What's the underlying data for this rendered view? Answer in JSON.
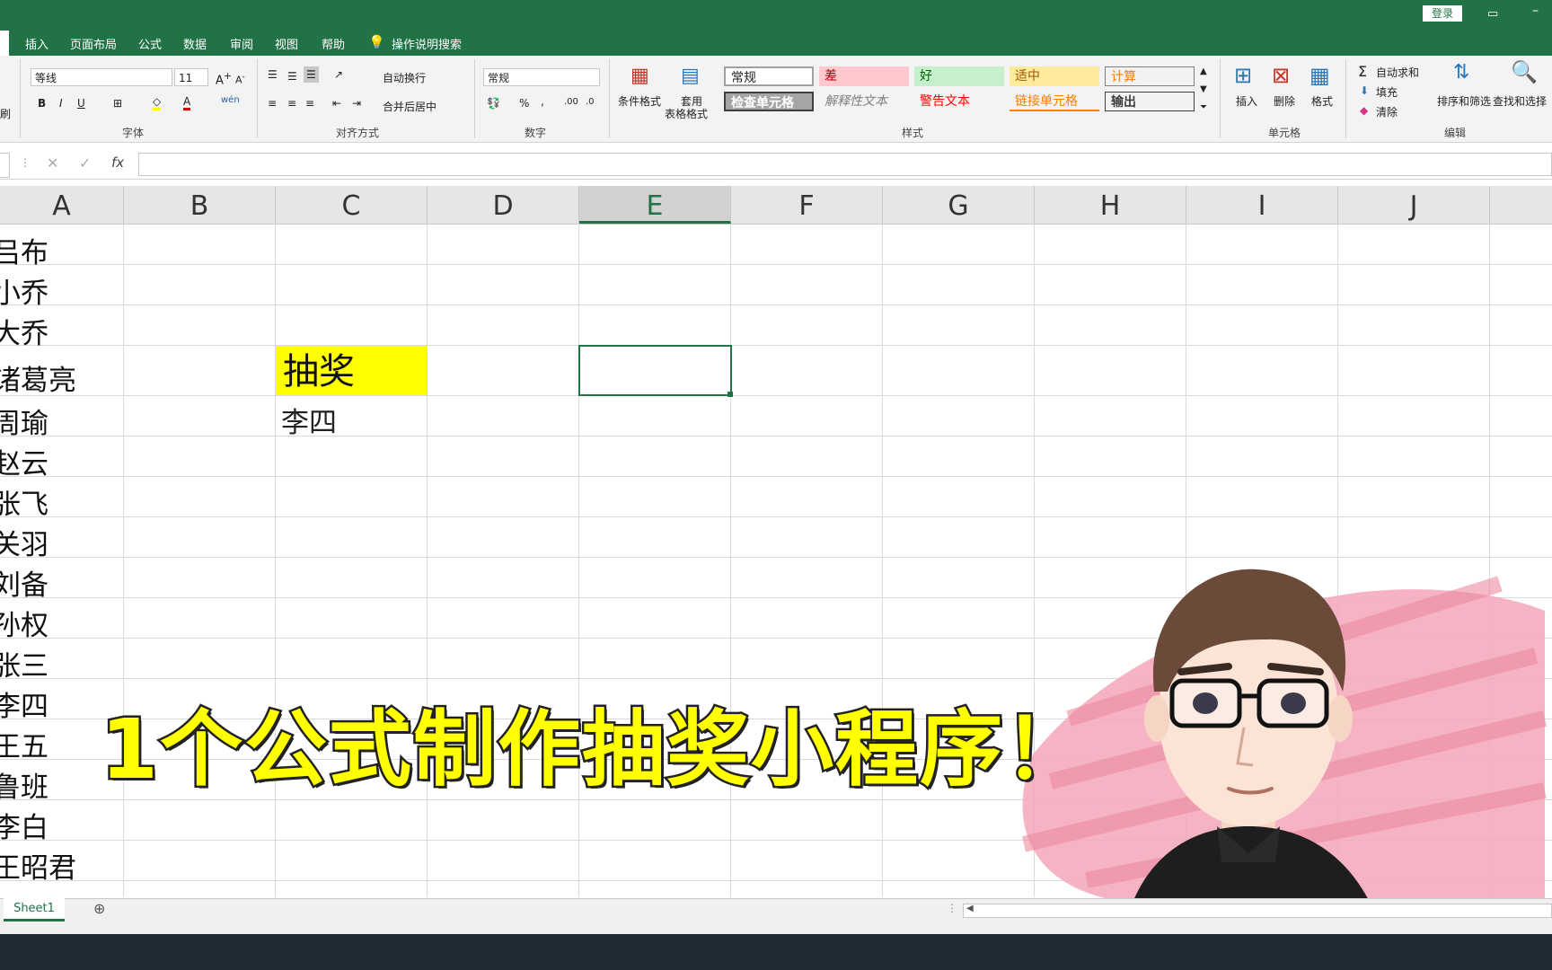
{
  "ribbon": {
    "tabs": [
      "插入",
      "页面布局",
      "公式",
      "数据",
      "审阅",
      "视图",
      "帮助",
      "操作说明搜索"
    ],
    "login_label": "登录",
    "font_name": "等线",
    "font_size": "11",
    "wrap_text": "自动换行",
    "merge_center": "合并后居中",
    "number_format": "常规",
    "conditional_format": "条件格式",
    "format_as_table_1": "套用",
    "format_as_table_2": "表格格式",
    "group_labels": {
      "font": "字体",
      "align": "对齐方式",
      "number": "数字",
      "styles": "样式",
      "cells": "单元格",
      "editing": "编辑"
    },
    "styles": {
      "normal": "常规",
      "bad": "差",
      "good": "好",
      "neutral": "适中",
      "calc": "计算",
      "check": "检查单元格",
      "explain": "解释性文本",
      "warn": "警告文本",
      "link": "链接单元格",
      "output": "输出"
    },
    "cells": {
      "insert": "插入",
      "delete": "删除",
      "format": "格式"
    },
    "editing": {
      "autosum": "自动求和",
      "fill": "填充",
      "clear": "清除",
      "sort": "排序和筛选",
      "find": "查找和选择"
    },
    "brush_label": "刷"
  },
  "formula_bar": {
    "fx": "fx",
    "content": ""
  },
  "columns": [
    "A",
    "B",
    "C",
    "D",
    "E",
    "F",
    "G",
    "H",
    "I",
    "J"
  ],
  "column_a_values": [
    "吕布",
    "小乔",
    "大乔",
    "诸葛亮",
    "周瑜",
    "赵云",
    "张飞",
    "关羽",
    "刘备",
    "孙权",
    "张三",
    "李四",
    "王五",
    "鲁班",
    "李白",
    "王昭君"
  ],
  "cell_c4": "抽奖",
  "cell_c5": "李四",
  "selected_column": "E",
  "sheet_tab": "Sheet1",
  "headline": "1个公式制作抽奖小程序！",
  "colors": {
    "excel_green": "#217346",
    "highlight_yellow": "#ffff00",
    "headline_yellow": "#ffff00",
    "bad_bg": "#ffc7ce",
    "good_bg": "#c6efce",
    "neutral_bg": "#ffeb9c"
  }
}
